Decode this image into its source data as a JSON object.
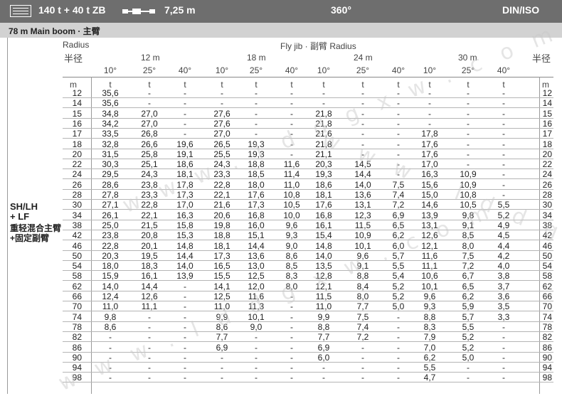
{
  "header": {
    "config": "140 t + 40 t ZB",
    "axle": "7,25 m",
    "rotation": "360°",
    "standard": "DIN/ISO"
  },
  "subheader": {
    "title": "78 m   Main boom · 主臂"
  },
  "table": {
    "radius_label": "Radius",
    "radius_cn_left": "半径",
    "radius_cn_right": "半径",
    "jib_label": "Fly jib ·  副臂  Radius",
    "jib_lengths": [
      "12 m",
      "18 m",
      "24 m",
      "30 m"
    ],
    "angles": [
      "10°",
      "25°",
      "40°",
      "10°",
      "25°",
      "40°",
      "10°",
      "25°",
      "40°",
      "10°",
      "25°",
      "40°"
    ],
    "unit_left": "m",
    "unit_right": "m",
    "unit_t": "t",
    "rows": [
      {
        "r": "12",
        "v": [
          "35,6",
          "-",
          "-",
          "-",
          "-",
          "-",
          "-",
          "-",
          "-",
          "-",
          "-",
          "-"
        ]
      },
      {
        "r": "14",
        "v": [
          "35,6",
          "-",
          "-",
          "-",
          "-",
          "-",
          "-",
          "-",
          "-",
          "-",
          "-",
          "-"
        ]
      },
      {
        "r": "15",
        "v": [
          "34,8",
          "27,0",
          "-",
          "27,6",
          "-",
          "-",
          "21,8",
          "-",
          "-",
          "-",
          "-",
          "-"
        ]
      },
      {
        "r": "16",
        "v": [
          "34,2",
          "27,0",
          "-",
          "27,6",
          "-",
          "-",
          "21,8",
          "-",
          "-",
          "-",
          "-",
          "-"
        ]
      },
      {
        "r": "17",
        "v": [
          "33,5",
          "26,8",
          "-",
          "27,0",
          "-",
          "-",
          "21,6",
          "-",
          "-",
          "17,8",
          "-",
          "-"
        ]
      },
      {
        "r": "18",
        "v": [
          "32,8",
          "26,6",
          "19,6",
          "26,5",
          "19,3",
          "-",
          "21,8",
          "-",
          "-",
          "17,6",
          "-",
          "-"
        ]
      },
      {
        "r": "20",
        "v": [
          "31,5",
          "25,8",
          "19,1",
          "25,5",
          "19,3",
          "-",
          "21,1",
          "-",
          "-",
          "17,6",
          "-",
          "-"
        ]
      },
      {
        "r": "22",
        "v": [
          "30,3",
          "25,1",
          "18,6",
          "24,3",
          "18,8",
          "11,6",
          "20,3",
          "14,5",
          "-",
          "17,0",
          "-",
          "-"
        ]
      },
      {
        "r": "24",
        "v": [
          "29,5",
          "24,3",
          "18,1",
          "23,3",
          "18,5",
          "11,4",
          "19,3",
          "14,4",
          "-",
          "16,3",
          "10,9",
          "-"
        ]
      },
      {
        "r": "26",
        "v": [
          "28,6",
          "23,8",
          "17,8",
          "22,8",
          "18,0",
          "11,0",
          "18,6",
          "14,0",
          "7,5",
          "15,6",
          "10,9",
          "-"
        ]
      },
      {
        "r": "28",
        "v": [
          "27,8",
          "23,3",
          "17,3",
          "22,1",
          "17,6",
          "10,8",
          "18,1",
          "13,6",
          "7,4",
          "15,0",
          "10,8",
          "-"
        ]
      },
      {
        "r": "30",
        "v": [
          "27,1",
          "22,8",
          "17,0",
          "21,6",
          "17,3",
          "10,5",
          "17,6",
          "13,1",
          "7,2",
          "14,6",
          "10,5",
          "5,5"
        ]
      },
      {
        "r": "34",
        "v": [
          "26,1",
          "22,1",
          "16,3",
          "20,6",
          "16,8",
          "10,0",
          "16,8",
          "12,3",
          "6,9",
          "13,9",
          "9,8",
          "5,2"
        ]
      },
      {
        "r": "38",
        "v": [
          "25,0",
          "21,5",
          "15,8",
          "19,8",
          "16,0",
          "9,6",
          "16,1",
          "11,5",
          "6,5",
          "13,1",
          "9,1",
          "4,9"
        ]
      },
      {
        "r": "42",
        "v": [
          "23,8",
          "20,8",
          "15,3",
          "18,8",
          "15,1",
          "9,3",
          "15,4",
          "10,9",
          "6,2",
          "12,6",
          "8,5",
          "4,5"
        ]
      },
      {
        "r": "46",
        "v": [
          "22,8",
          "20,1",
          "14,8",
          "18,1",
          "14,4",
          "9,0",
          "14,8",
          "10,1",
          "6,0",
          "12,1",
          "8,0",
          "4,4"
        ]
      },
      {
        "r": "50",
        "v": [
          "20,3",
          "19,5",
          "14,4",
          "17,3",
          "13,6",
          "8,6",
          "14,0",
          "9,6",
          "5,7",
          "11,6",
          "7,5",
          "4,2"
        ]
      },
      {
        "r": "54",
        "v": [
          "18,0",
          "18,3",
          "14,0",
          "16,5",
          "13,0",
          "8,5",
          "13,5",
          "9,1",
          "5,5",
          "11,1",
          "7,2",
          "4,0"
        ]
      },
      {
        "r": "58",
        "v": [
          "15,9",
          "16,1",
          "13,9",
          "15,5",
          "12,5",
          "8,3",
          "12,8",
          "8,8",
          "5,4",
          "10,6",
          "6,7",
          "3,8"
        ]
      },
      {
        "r": "62",
        "v": [
          "14,0",
          "14,4",
          "-",
          "14,1",
          "12,0",
          "8,0",
          "12,1",
          "8,4",
          "5,2",
          "10,1",
          "6,5",
          "3,7"
        ]
      },
      {
        "r": "66",
        "v": [
          "12,4",
          "12,6",
          "-",
          "12,5",
          "11,6",
          "-",
          "11,5",
          "8,0",
          "5,2",
          "9,6",
          "6,2",
          "3,6"
        ]
      },
      {
        "r": "70",
        "v": [
          "11,0",
          "11,1",
          "-",
          "11,0",
          "11,3",
          "-",
          "11,0",
          "7,7",
          "5,0",
          "9,3",
          "5,9",
          "3,5"
        ]
      },
      {
        "r": "74",
        "v": [
          "9,8",
          "-",
          "-",
          "9,9",
          "10,1",
          "-",
          "9,9",
          "7,5",
          "-",
          "8,8",
          "5,7",
          "3,3"
        ]
      },
      {
        "r": "78",
        "v": [
          "8,6",
          "-",
          "-",
          "8,6",
          "9,0",
          "-",
          "8,8",
          "7,4",
          "-",
          "8,3",
          "5,5",
          "-"
        ]
      },
      {
        "r": "82",
        "v": [
          "-",
          "-",
          "-",
          "7,7",
          "-",
          "-",
          "7,7",
          "7,2",
          "-",
          "7,9",
          "5,2",
          "-"
        ]
      },
      {
        "r": "86",
        "v": [
          "-",
          "-",
          "-",
          "6,9",
          "-",
          "-",
          "6,9",
          "-",
          "-",
          "7,0",
          "5,2",
          "-"
        ]
      },
      {
        "r": "90",
        "v": [
          "-",
          "-",
          "-",
          "-",
          "-",
          "-",
          "6,0",
          "-",
          "-",
          "6,2",
          "5,0",
          "-"
        ]
      },
      {
        "r": "94",
        "v": [
          "-",
          "-",
          "-",
          "-",
          "-",
          "-",
          "-",
          "-",
          "-",
          "5,5",
          "-",
          "-"
        ]
      },
      {
        "r": "98",
        "v": [
          "-",
          "-",
          "-",
          "-",
          "-",
          "-",
          "-",
          "-",
          "-",
          "4,7",
          "-",
          "-"
        ]
      }
    ]
  },
  "side_label": [
    "SH/LH",
    "+ LF",
    "重轻混合主臂",
    "+固定副臂"
  ],
  "watermark": "w w w . l d d g x w . c o m"
}
